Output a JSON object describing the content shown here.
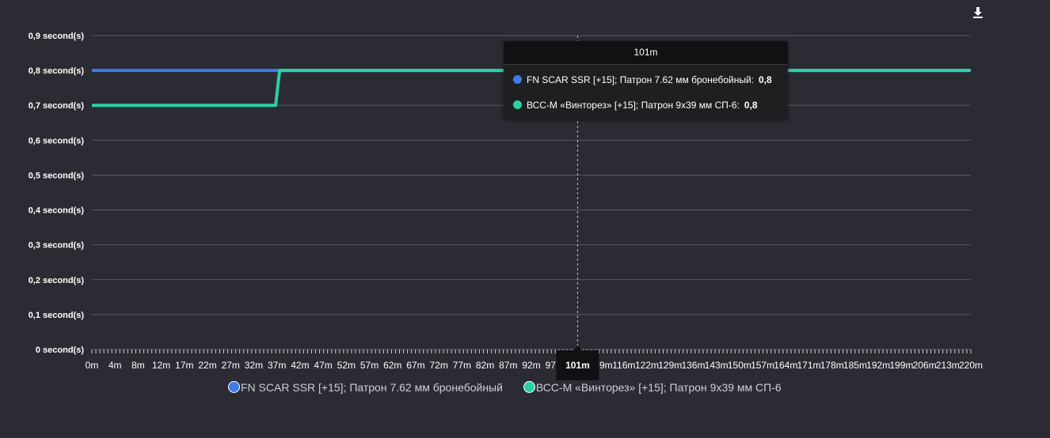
{
  "chart_data": {
    "type": "line",
    "x_ticks": [
      "0m",
      "4m",
      "8m",
      "12m",
      "17m",
      "22m",
      "27m",
      "32m",
      "37m",
      "42m",
      "47m",
      "52m",
      "57m",
      "62m",
      "67m",
      "72m",
      "77m",
      "82m",
      "87m",
      "92m",
      "97m",
      "101m",
      "109m",
      "116m",
      "122m",
      "129m",
      "136m",
      "143m",
      "150m",
      "157m",
      "164m",
      "171m",
      "178m",
      "185m",
      "192m",
      "199m",
      "206m",
      "213m",
      "220m"
    ],
    "y_ticks": [
      "0 second(s)",
      "0,1 second(s)",
      "0,2 second(s)",
      "0,3 second(s)",
      "0,4 second(s)",
      "0,5 second(s)",
      "0,6 second(s)",
      "0,7 second(s)",
      "0,8 second(s)",
      "0,9 second(s)"
    ],
    "ylim": [
      0,
      0.9
    ],
    "xlim": [
      0,
      220
    ],
    "series": [
      {
        "name": "FN SCAR SSR [+15]; Патрон 7.62 мм бронебойный",
        "color": "#3d7be6",
        "points": [
          [
            0,
            0.8
          ],
          [
            220,
            0.8
          ]
        ]
      },
      {
        "name": "ВСС-М «Винторез» [+15]; Патрон 9х39 мм СП-6",
        "color": "#2ad1a4",
        "points": [
          [
            0,
            0.7
          ],
          [
            46,
            0.7
          ],
          [
            47,
            0.8
          ],
          [
            220,
            0.8
          ]
        ]
      }
    ],
    "crosshair_x_label": "101m",
    "grid": true,
    "legend_position": "bottom"
  },
  "tooltip": {
    "title": "101m",
    "rows": [
      {
        "label": "FN SCAR SSR [+15]; Патрон 7.62 мм бронебойный:",
        "value": "0,8",
        "color": "#3d7be6"
      },
      {
        "label": "ВСС-М «Винторез» [+15]; Патрон 9х39 мм СП-6:",
        "value": "0,8",
        "color": "#2ad1a4"
      }
    ]
  },
  "legend": [
    {
      "label": "FN SCAR SSR [+15]; Патрон 7.62 мм бронебойный",
      "color": "#3d7be6"
    },
    {
      "label": "ВСС-М «Винторез» [+15]; Патрон 9х39 мм СП-6",
      "color": "#2ad1a4"
    }
  ],
  "toolbar": {
    "download_icon": "download-icon"
  }
}
